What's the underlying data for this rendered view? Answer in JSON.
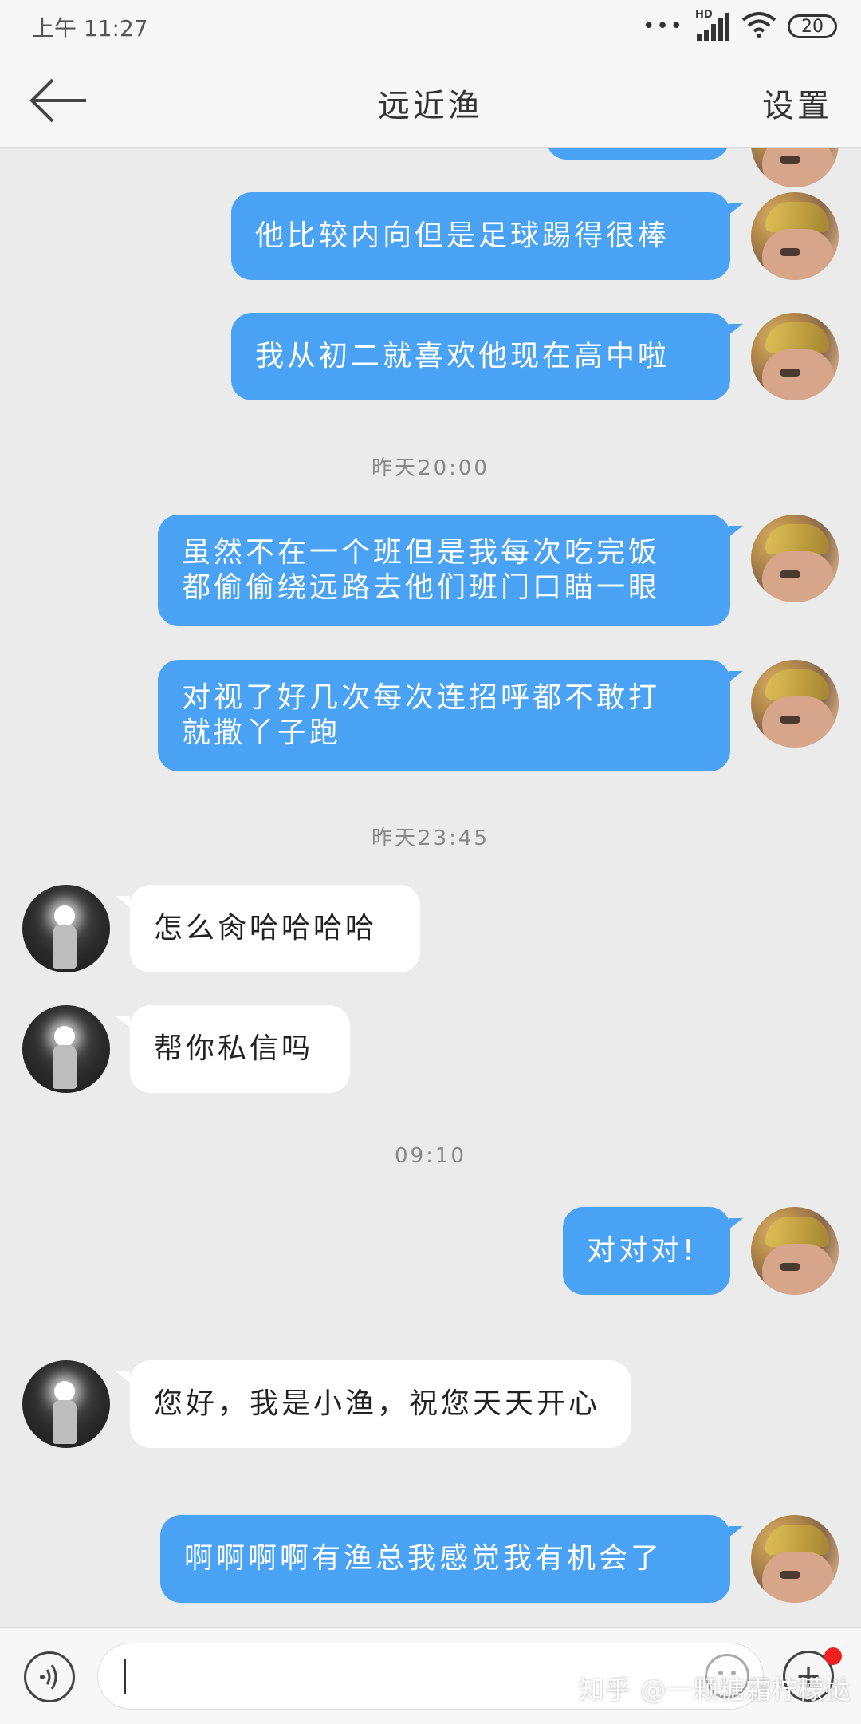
{
  "status_bar": {
    "time": "上午 11:27",
    "dots": "•••",
    "network_label": "HD",
    "battery": "20"
  },
  "header": {
    "title": "远近渔",
    "settings_label": "设置"
  },
  "messages": [
    {
      "side": "out",
      "text": "他比较内向但是足球踢得很棒"
    },
    {
      "side": "out",
      "text": "我从初二就喜欢他现在高中啦"
    },
    {
      "type": "timestamp",
      "text": "昨天20:00"
    },
    {
      "side": "out",
      "text": "虽然不在一个班但是我每次吃完饭\n都偷偷绕远路去他们班门口瞄一眼"
    },
    {
      "side": "out",
      "text": "对视了好几次每次连招呼都不敢打\n就撒丫子跑"
    },
    {
      "type": "timestamp",
      "text": "昨天23:45"
    },
    {
      "side": "in",
      "text": "怎么肏哈哈哈哈"
    },
    {
      "side": "in",
      "text": "帮你私信吗"
    },
    {
      "type": "timestamp",
      "text": "09:10"
    },
    {
      "side": "out",
      "text": "对对对!"
    },
    {
      "side": "in",
      "text": "您好，我是小渔，祝您天天开心"
    },
    {
      "side": "out",
      "text": "啊啊啊啊有渔总我感觉我有机会了"
    }
  ],
  "input": {
    "value": "",
    "placeholder": ""
  },
  "watermark": "知乎 @一颗糖霜柠檬挞",
  "colors": {
    "outgoing_bubble": "#4aa2f5",
    "incoming_bubble": "#ffffff",
    "background": "#ebebeb",
    "notification_dot": "#f02020"
  }
}
